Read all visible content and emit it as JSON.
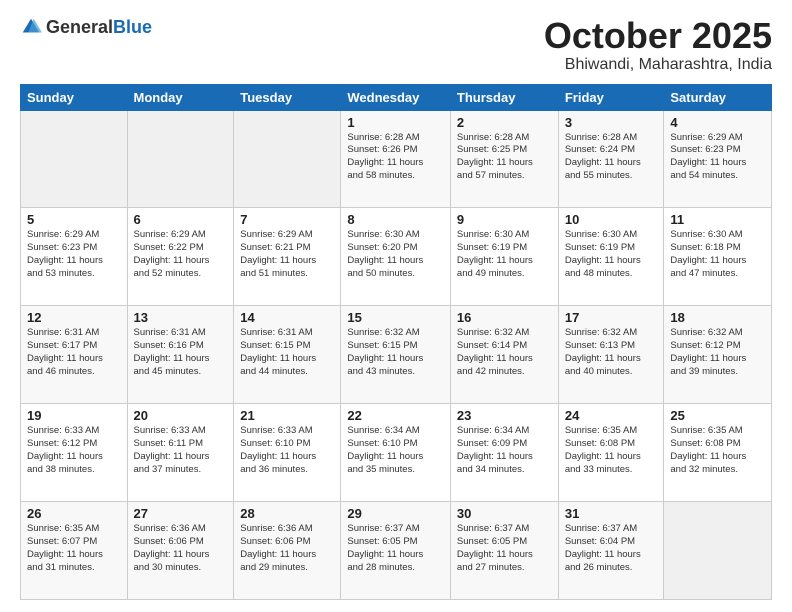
{
  "header": {
    "logo_general": "General",
    "logo_blue": "Blue",
    "month_year": "October 2025",
    "location": "Bhiwandi, Maharashtra, India"
  },
  "days_of_week": [
    "Sunday",
    "Monday",
    "Tuesday",
    "Wednesday",
    "Thursday",
    "Friday",
    "Saturday"
  ],
  "weeks": [
    [
      {
        "day": "",
        "info": ""
      },
      {
        "day": "",
        "info": ""
      },
      {
        "day": "",
        "info": ""
      },
      {
        "day": "1",
        "info": "Sunrise: 6:28 AM\nSunset: 6:26 PM\nDaylight: 11 hours\nand 58 minutes."
      },
      {
        "day": "2",
        "info": "Sunrise: 6:28 AM\nSunset: 6:25 PM\nDaylight: 11 hours\nand 57 minutes."
      },
      {
        "day": "3",
        "info": "Sunrise: 6:28 AM\nSunset: 6:24 PM\nDaylight: 11 hours\nand 55 minutes."
      },
      {
        "day": "4",
        "info": "Sunrise: 6:29 AM\nSunset: 6:23 PM\nDaylight: 11 hours\nand 54 minutes."
      }
    ],
    [
      {
        "day": "5",
        "info": "Sunrise: 6:29 AM\nSunset: 6:23 PM\nDaylight: 11 hours\nand 53 minutes."
      },
      {
        "day": "6",
        "info": "Sunrise: 6:29 AM\nSunset: 6:22 PM\nDaylight: 11 hours\nand 52 minutes."
      },
      {
        "day": "7",
        "info": "Sunrise: 6:29 AM\nSunset: 6:21 PM\nDaylight: 11 hours\nand 51 minutes."
      },
      {
        "day": "8",
        "info": "Sunrise: 6:30 AM\nSunset: 6:20 PM\nDaylight: 11 hours\nand 50 minutes."
      },
      {
        "day": "9",
        "info": "Sunrise: 6:30 AM\nSunset: 6:19 PM\nDaylight: 11 hours\nand 49 minutes."
      },
      {
        "day": "10",
        "info": "Sunrise: 6:30 AM\nSunset: 6:19 PM\nDaylight: 11 hours\nand 48 minutes."
      },
      {
        "day": "11",
        "info": "Sunrise: 6:30 AM\nSunset: 6:18 PM\nDaylight: 11 hours\nand 47 minutes."
      }
    ],
    [
      {
        "day": "12",
        "info": "Sunrise: 6:31 AM\nSunset: 6:17 PM\nDaylight: 11 hours\nand 46 minutes."
      },
      {
        "day": "13",
        "info": "Sunrise: 6:31 AM\nSunset: 6:16 PM\nDaylight: 11 hours\nand 45 minutes."
      },
      {
        "day": "14",
        "info": "Sunrise: 6:31 AM\nSunset: 6:15 PM\nDaylight: 11 hours\nand 44 minutes."
      },
      {
        "day": "15",
        "info": "Sunrise: 6:32 AM\nSunset: 6:15 PM\nDaylight: 11 hours\nand 43 minutes."
      },
      {
        "day": "16",
        "info": "Sunrise: 6:32 AM\nSunset: 6:14 PM\nDaylight: 11 hours\nand 42 minutes."
      },
      {
        "day": "17",
        "info": "Sunrise: 6:32 AM\nSunset: 6:13 PM\nDaylight: 11 hours\nand 40 minutes."
      },
      {
        "day": "18",
        "info": "Sunrise: 6:32 AM\nSunset: 6:12 PM\nDaylight: 11 hours\nand 39 minutes."
      }
    ],
    [
      {
        "day": "19",
        "info": "Sunrise: 6:33 AM\nSunset: 6:12 PM\nDaylight: 11 hours\nand 38 minutes."
      },
      {
        "day": "20",
        "info": "Sunrise: 6:33 AM\nSunset: 6:11 PM\nDaylight: 11 hours\nand 37 minutes."
      },
      {
        "day": "21",
        "info": "Sunrise: 6:33 AM\nSunset: 6:10 PM\nDaylight: 11 hours\nand 36 minutes."
      },
      {
        "day": "22",
        "info": "Sunrise: 6:34 AM\nSunset: 6:10 PM\nDaylight: 11 hours\nand 35 minutes."
      },
      {
        "day": "23",
        "info": "Sunrise: 6:34 AM\nSunset: 6:09 PM\nDaylight: 11 hours\nand 34 minutes."
      },
      {
        "day": "24",
        "info": "Sunrise: 6:35 AM\nSunset: 6:08 PM\nDaylight: 11 hours\nand 33 minutes."
      },
      {
        "day": "25",
        "info": "Sunrise: 6:35 AM\nSunset: 6:08 PM\nDaylight: 11 hours\nand 32 minutes."
      }
    ],
    [
      {
        "day": "26",
        "info": "Sunrise: 6:35 AM\nSunset: 6:07 PM\nDaylight: 11 hours\nand 31 minutes."
      },
      {
        "day": "27",
        "info": "Sunrise: 6:36 AM\nSunset: 6:06 PM\nDaylight: 11 hours\nand 30 minutes."
      },
      {
        "day": "28",
        "info": "Sunrise: 6:36 AM\nSunset: 6:06 PM\nDaylight: 11 hours\nand 29 minutes."
      },
      {
        "day": "29",
        "info": "Sunrise: 6:37 AM\nSunset: 6:05 PM\nDaylight: 11 hours\nand 28 minutes."
      },
      {
        "day": "30",
        "info": "Sunrise: 6:37 AM\nSunset: 6:05 PM\nDaylight: 11 hours\nand 27 minutes."
      },
      {
        "day": "31",
        "info": "Sunrise: 6:37 AM\nSunset: 6:04 PM\nDaylight: 11 hours\nand 26 minutes."
      },
      {
        "day": "",
        "info": ""
      }
    ]
  ]
}
